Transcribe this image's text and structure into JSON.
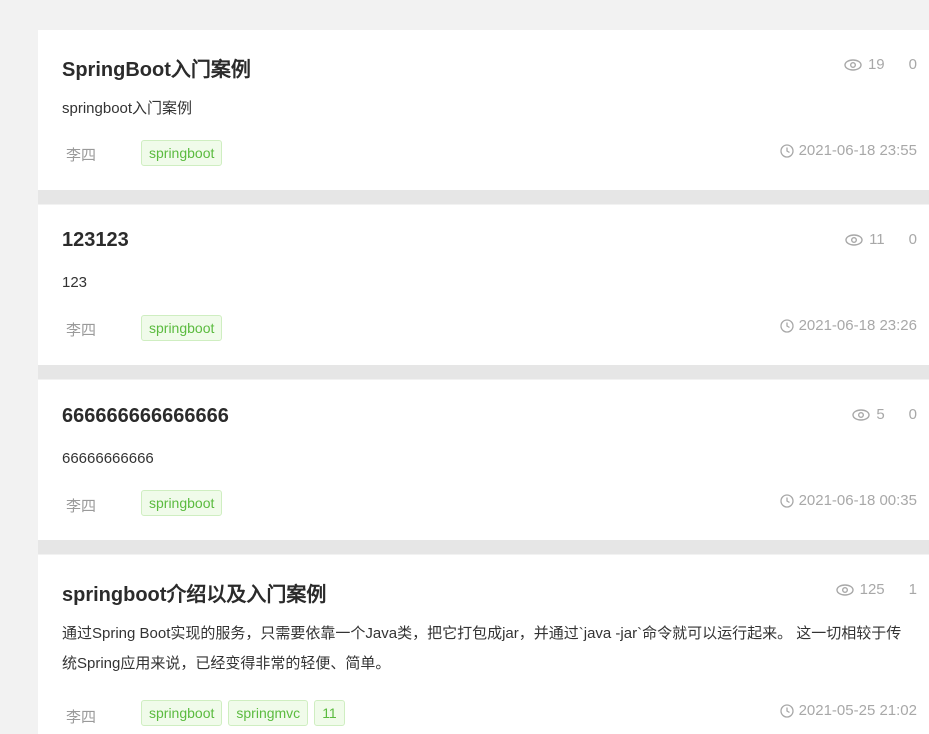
{
  "articles": [
    {
      "title": "SpringBoot入门案例",
      "views": "19",
      "likes": "0",
      "summary": "springboot入门案例",
      "author": "李四",
      "tags": [
        "springboot"
      ],
      "date": "2021-06-18 23:55"
    },
    {
      "title": "123123",
      "views": "11",
      "likes": "0",
      "summary": "123",
      "author": "李四",
      "tags": [
        "springboot"
      ],
      "date": "2021-06-18 23:26"
    },
    {
      "title": "666666666666666",
      "views": "5",
      "likes": "0",
      "summary": "66666666666",
      "author": "李四",
      "tags": [
        "springboot"
      ],
      "date": "2021-06-18 00:35"
    },
    {
      "title": "springboot介绍以及入门案例",
      "views": "125",
      "likes": "1",
      "summary": "通过Spring Boot实现的服务，只需要依靠一个Java类，把它打包成jar，并通过`java -jar`命令就可以运行起来。 这一切相较于传统Spring应用来说，已经变得非常的轻便、简单。",
      "author": "李四",
      "tags": [
        "springboot",
        "springmvc",
        "11"
      ],
      "date": "2021-05-25 21:02"
    }
  ]
}
